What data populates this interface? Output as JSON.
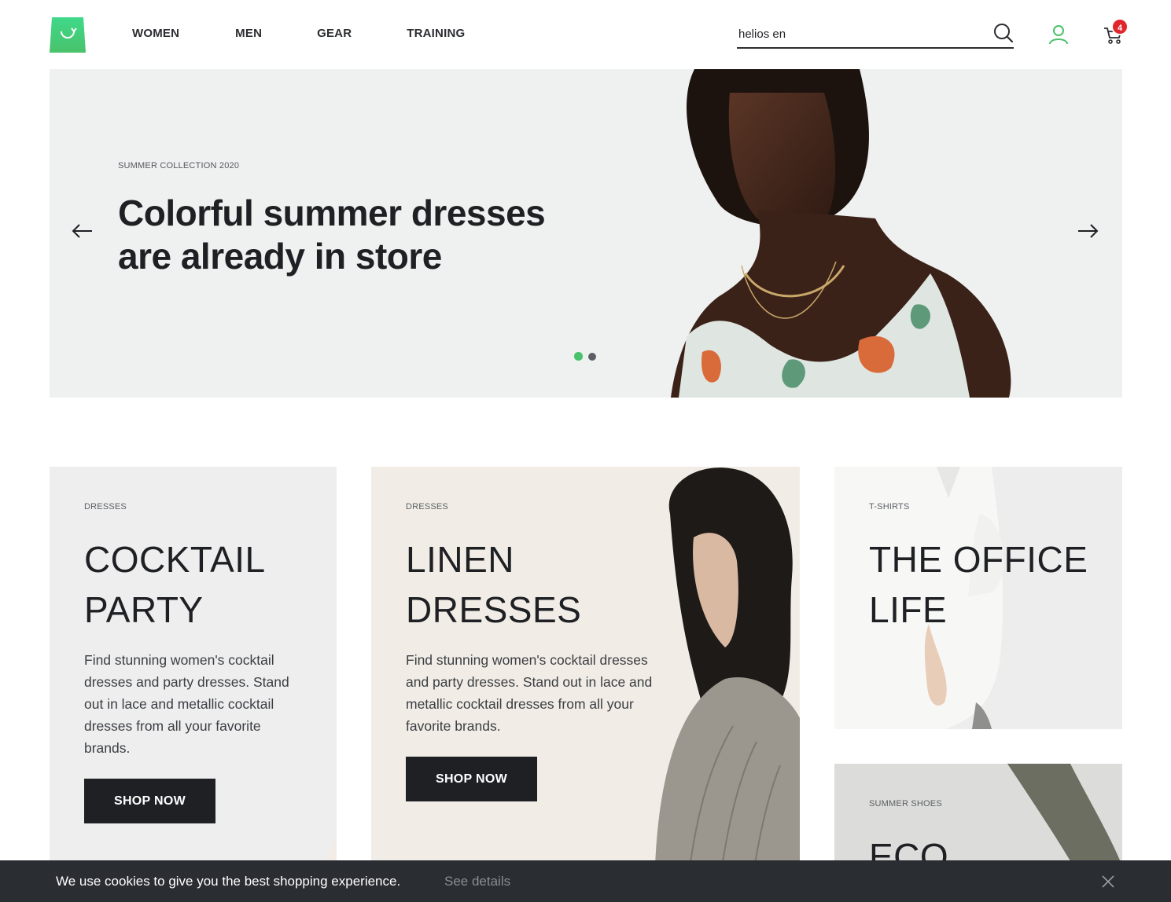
{
  "header": {
    "nav": [
      "WOMEN",
      "MEN",
      "GEAR",
      "TRAINING"
    ],
    "search": {
      "value": "helios en"
    },
    "cart_count": "4"
  },
  "hero": {
    "eyebrow": "SUMMER COLLECTION 2020",
    "title_line1": "Colorful summer dresses",
    "title_line2": "are already in store",
    "slides": 2,
    "active_slide": 1
  },
  "cards": [
    {
      "eyebrow": "DRESSES",
      "title_line1": "COCKTAIL",
      "title_line2": "PARTY",
      "text": "Find stunning women's cocktail dresses and party dresses. Stand out in lace and metallic cocktail dresses from all your favorite brands.",
      "button": "SHOP NOW"
    },
    {
      "eyebrow": "DRESSES",
      "title_line1": "LINEN",
      "title_line2": "DRESSES",
      "text": "Find stunning women's cocktail dresses and party dresses. Stand out in lace and metallic cocktail dresses from all your favorite brands.",
      "button": "SHOP NOW"
    },
    {
      "eyebrow": "T-SHIRTS",
      "title_line1": "THE OFFICE",
      "title_line2": "LIFE"
    },
    {
      "eyebrow": "SUMMER SHOES",
      "title_line1": "ECO"
    }
  ],
  "cookie": {
    "text": "We use cookies to give you the best shopping experience.",
    "link": "See details"
  },
  "colors": {
    "brand_green": "#4ac26b",
    "dark": "#1f2024",
    "badge_red": "#e0262c",
    "hero_bg": "#eff1f0"
  }
}
